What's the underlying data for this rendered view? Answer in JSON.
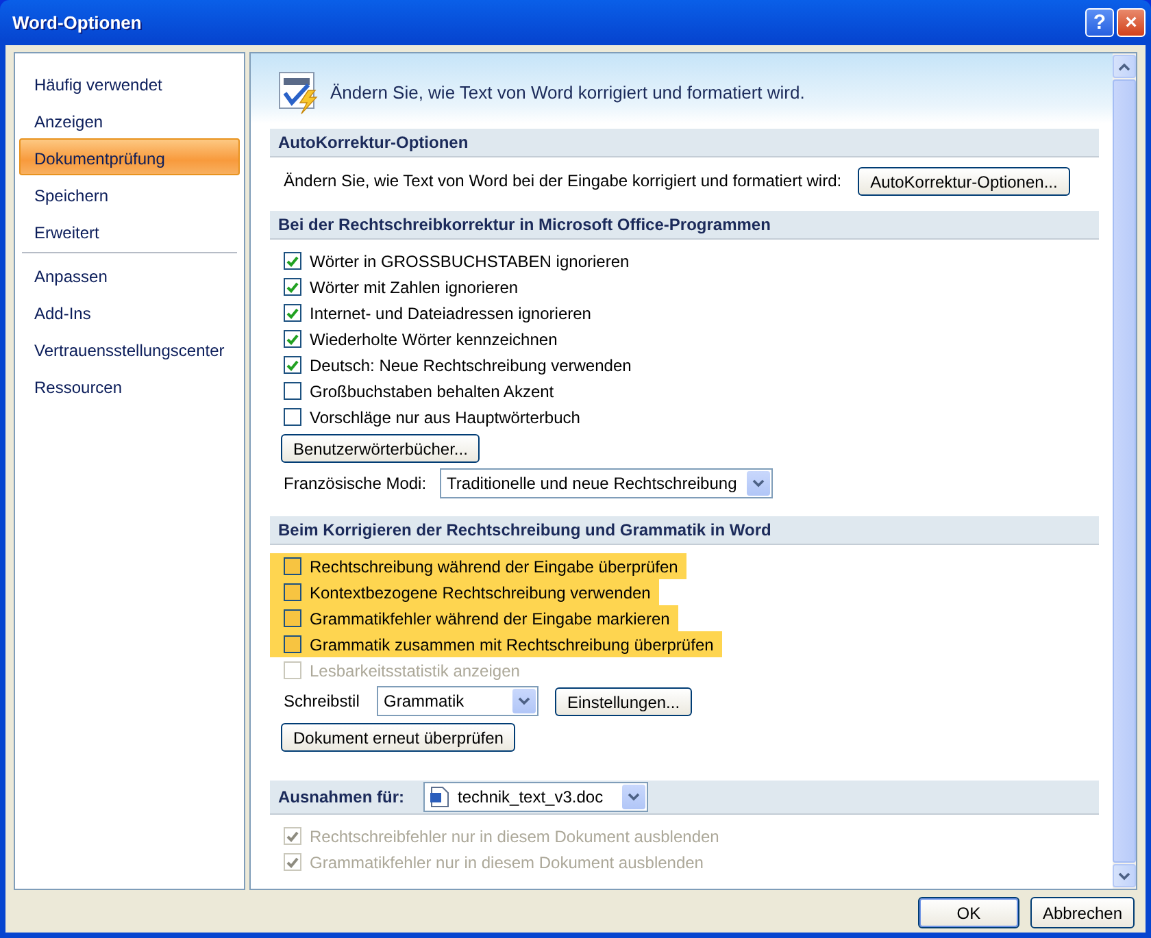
{
  "window": {
    "title": "Word-Optionen",
    "help": "?",
    "close": "×"
  },
  "sidebar": {
    "items": [
      {
        "label": "Häufig verwendet",
        "selected": false,
        "separator_after": false
      },
      {
        "label": "Anzeigen",
        "selected": false,
        "separator_after": false
      },
      {
        "label": "Dokumentprüfung",
        "selected": true,
        "separator_after": false
      },
      {
        "label": "Speichern",
        "selected": false,
        "separator_after": false
      },
      {
        "label": "Erweitert",
        "selected": false,
        "separator_after": true
      },
      {
        "label": "Anpassen",
        "selected": false,
        "separator_after": false
      },
      {
        "label": "Add-Ins",
        "selected": false,
        "separator_after": false
      },
      {
        "label": "Vertrauensstellungscenter",
        "selected": false,
        "separator_after": false
      },
      {
        "label": "Ressourcen",
        "selected": false,
        "separator_after": false
      }
    ]
  },
  "header": {
    "text": "Ändern Sie, wie Text von Word korrigiert und formatiert wird."
  },
  "sections": [
    {
      "title": "AutoKorrektur-Optionen",
      "rows": [
        {
          "kind": "button-row",
          "label": "Ändern Sie, wie Text von Word bei der Eingabe korrigiert und formatiert wird:",
          "button": "AutoKorrektur-Optionen..."
        }
      ]
    },
    {
      "title": "Bei der Rechtschreibkorrektur in Microsoft Office-Programmen",
      "rows": [
        {
          "kind": "checkbox",
          "label": "Wörter in GROSSBUCHSTABEN ignorieren",
          "checked": true,
          "disabled": false,
          "highlighted": false
        },
        {
          "kind": "checkbox",
          "label": "Wörter mit Zahlen ignorieren",
          "checked": true,
          "disabled": false,
          "highlighted": false
        },
        {
          "kind": "checkbox",
          "label": "Internet- und Dateiadressen ignorieren",
          "checked": true,
          "disabled": false,
          "highlighted": false
        },
        {
          "kind": "checkbox",
          "label": "Wiederholte Wörter kennzeichnen",
          "checked": true,
          "disabled": false,
          "highlighted": false
        },
        {
          "kind": "checkbox",
          "label": "Deutsch: Neue Rechtschreibung verwenden",
          "checked": true,
          "disabled": false,
          "highlighted": false
        },
        {
          "kind": "checkbox",
          "label": "Großbuchstaben behalten Akzent",
          "checked": false,
          "disabled": false,
          "highlighted": false
        },
        {
          "kind": "checkbox",
          "label": "Vorschläge nur aus Hauptwörterbuch",
          "checked": false,
          "disabled": false,
          "highlighted": false
        },
        {
          "kind": "button",
          "button": "Benutzerwörterbücher..."
        },
        {
          "kind": "select",
          "label": "Französische Modi:",
          "value": "Traditionelle und neue Rechtschreibung"
        }
      ]
    },
    {
      "title": "Beim Korrigieren der Rechtschreibung und Grammatik in Word",
      "rows": [
        {
          "kind": "checkbox",
          "label": "Rechtschreibung während der Eingabe überprüfen",
          "checked": false,
          "disabled": false,
          "highlighted": true
        },
        {
          "kind": "checkbox",
          "label": "Kontextbezogene Rechtschreibung verwenden",
          "checked": false,
          "disabled": false,
          "highlighted": true
        },
        {
          "kind": "checkbox",
          "label": "Grammatikfehler während der Eingabe markieren",
          "checked": false,
          "disabled": false,
          "highlighted": true
        },
        {
          "kind": "checkbox",
          "label": "Grammatik zusammen mit Rechtschreibung überprüfen",
          "checked": false,
          "disabled": false,
          "highlighted": true
        },
        {
          "kind": "checkbox",
          "label": "Lesbarkeitsstatistik anzeigen",
          "checked": false,
          "disabled": true,
          "highlighted": false
        },
        {
          "kind": "select-button",
          "label": "Schreibstil",
          "value": "Grammatik",
          "button": "Einstellungen..."
        },
        {
          "kind": "button",
          "button": "Dokument erneut überprüfen"
        }
      ]
    },
    {
      "title": "Ausnahmen für:",
      "select": "technik_text_v3.doc",
      "rows": [
        {
          "kind": "checkbox",
          "label": "Rechtschreibfehler nur in diesem Dokument ausblenden",
          "checked": true,
          "disabled": true,
          "highlighted": false
        },
        {
          "kind": "checkbox",
          "label": "Grammatikfehler nur in diesem Dokument ausblenden",
          "checked": true,
          "disabled": true,
          "highlighted": false
        }
      ]
    }
  ],
  "footer": {
    "buttons": [
      {
        "label": "OK",
        "default": true
      },
      {
        "label": "Abbrechen",
        "default": false
      }
    ]
  }
}
